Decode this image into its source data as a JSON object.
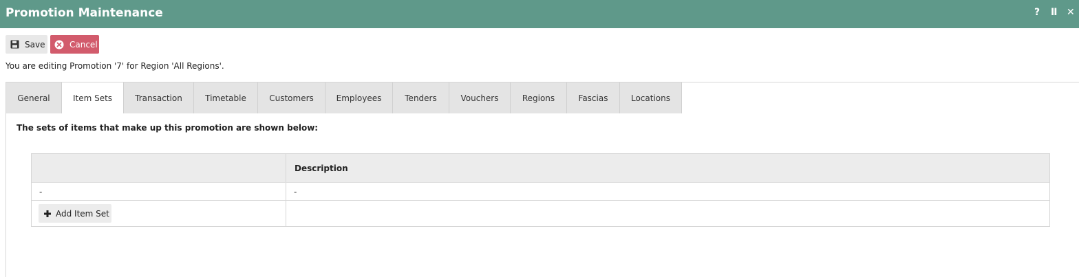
{
  "window": {
    "title": "Promotion Maintenance",
    "help_glyph": "?",
    "pause_glyph": "II",
    "close_glyph": "✕"
  },
  "toolbar": {
    "save_label": "Save",
    "cancel_label": "Cancel"
  },
  "info_text": "You are editing Promotion '7' for Region 'All Regions'.",
  "tabs": [
    {
      "label": "General"
    },
    {
      "label": "Item Sets"
    },
    {
      "label": "Transaction"
    },
    {
      "label": "Timetable"
    },
    {
      "label": "Customers"
    },
    {
      "label": "Employees"
    },
    {
      "label": "Tenders"
    },
    {
      "label": "Vouchers"
    },
    {
      "label": "Regions"
    },
    {
      "label": "Fascias"
    },
    {
      "label": "Locations"
    }
  ],
  "active_tab": "Item Sets",
  "item_sets": {
    "intro": "The sets of items that make up this promotion are shown below:",
    "columns": [
      "",
      "Description"
    ],
    "rows": [
      [
        "-",
        "-"
      ]
    ],
    "add_label": "Add Item Set"
  },
  "colors": {
    "titlebar": "#5f998a",
    "cancel": "#d25b6c"
  }
}
